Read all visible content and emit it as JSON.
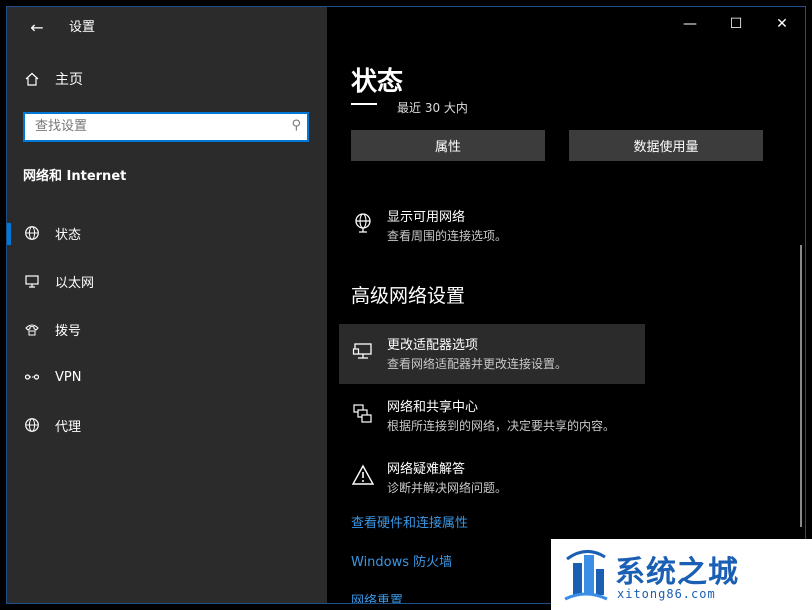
{
  "window": {
    "back": "←",
    "title": "设置",
    "minimize": "—",
    "maximize": "☐",
    "close": "✕"
  },
  "sidebar": {
    "home_label": "主页",
    "search_placeholder": "查找设置",
    "section_title": "网络和 Internet",
    "items": [
      {
        "label": "状态",
        "icon": "globe-icon",
        "active": true
      },
      {
        "label": "以太网",
        "icon": "monitor-icon"
      },
      {
        "label": "拨号",
        "icon": "phone-icon"
      },
      {
        "label": "VPN",
        "icon": "vpn-icon"
      },
      {
        "label": "代理",
        "icon": "globe-icon"
      }
    ]
  },
  "main": {
    "page_title": "状态",
    "recent_text": "最近 30 大内",
    "buttons": {
      "properties": "属性",
      "data_usage": "数据使用量"
    },
    "show_networks": {
      "title": "显示可用网络",
      "desc": "查看周围的连接选项。"
    },
    "advanced_title": "高级网络设置",
    "settings": [
      {
        "title": "更改适配器选项",
        "desc": "查看网络适配器并更改连接设置。",
        "icon": "adapter-icon"
      },
      {
        "title": "网络和共享中心",
        "desc": "根据所连接到的网络，决定要共享的内容。",
        "icon": "sharing-icon"
      },
      {
        "title": "网络疑难解答",
        "desc": "诊断并解决网络问题。",
        "icon": "warning-icon"
      }
    ],
    "links": [
      "查看硬件和连接属性",
      "Windows 防火墙",
      "网络重置"
    ]
  },
  "watermark": {
    "title": "系统之城",
    "url": "xitong86.com"
  },
  "colors": {
    "accent": "#0078d7",
    "link": "#3a96e3",
    "sidebar_bg": "#2b2b2b",
    "content_bg": "#000000"
  }
}
